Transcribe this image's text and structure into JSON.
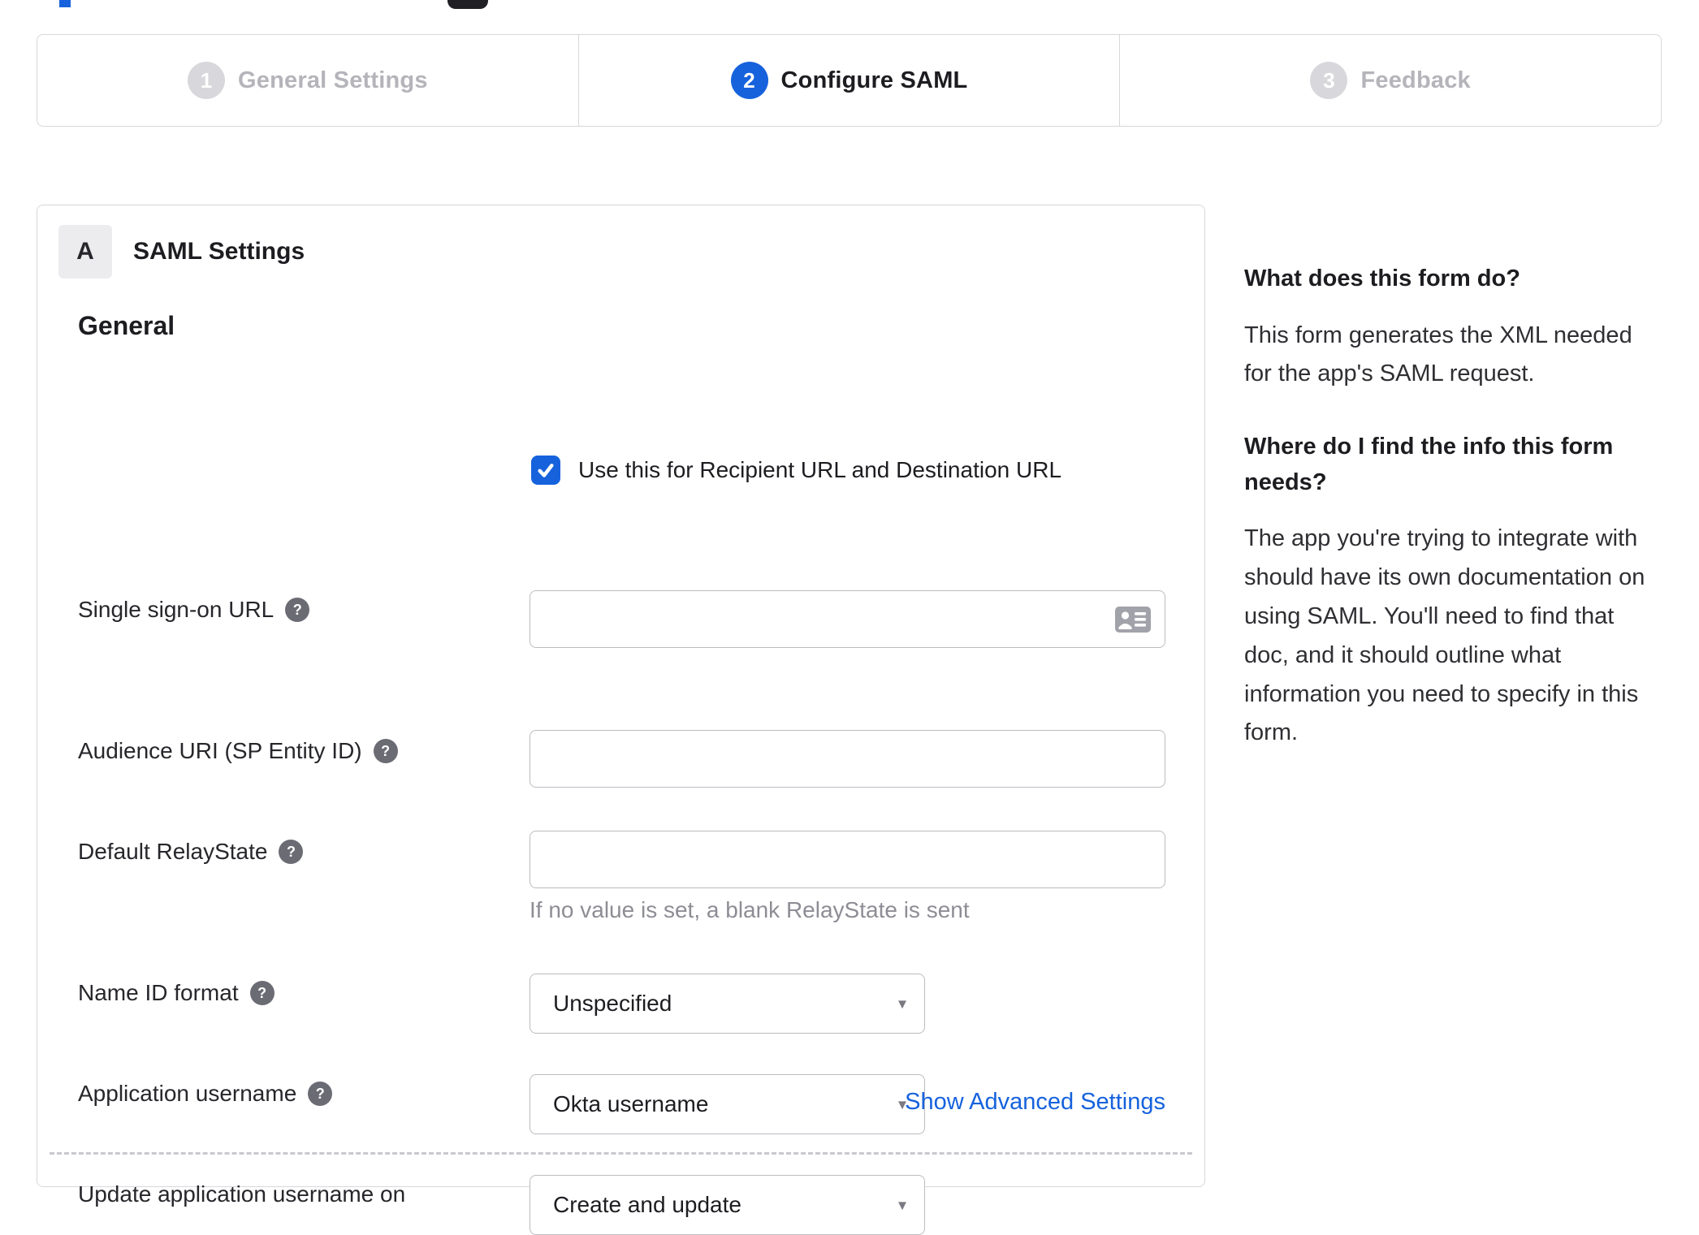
{
  "accent_color": "#1662dd",
  "icons": {
    "help_glyph": "?",
    "dropdown_arrow": "▾"
  },
  "stepper": {
    "steps": [
      {
        "number": "1",
        "label": "General Settings",
        "state": "inactive"
      },
      {
        "number": "2",
        "label": "Configure SAML",
        "state": "active"
      },
      {
        "number": "3",
        "label": "Feedback",
        "state": "inactive"
      }
    ]
  },
  "panel": {
    "badge": "A",
    "title": "SAML Settings",
    "section": "General",
    "fields": {
      "sso": {
        "label": "Single sign-on URL",
        "value": "",
        "checkbox_label": "Use this for Recipient URL and Destination URL",
        "checkbox_checked": true
      },
      "audience": {
        "label": "Audience URI (SP Entity ID)",
        "value": ""
      },
      "relay": {
        "label": "Default RelayState",
        "value": "",
        "hint": "If no value is set, a blank RelayState is sent"
      },
      "name_id": {
        "label": "Name ID format",
        "value": "Unspecified"
      },
      "app_username": {
        "label": "Application username",
        "value": "Okta username"
      },
      "update_username": {
        "label": "Update application username on",
        "value": "Create and update"
      }
    },
    "advanced_link": "Show Advanced Settings"
  },
  "help_panel": {
    "q1_heading": "What does this form do?",
    "q1_text": "This form generates the XML needed for the app's SAML request.",
    "q2_heading": "Where do I find the info this form needs?",
    "q2_text": "The app you're trying to integrate with should have its own documentation on using SAML. You'll need to find that doc, and it should outline what information you need to specify in this form."
  }
}
